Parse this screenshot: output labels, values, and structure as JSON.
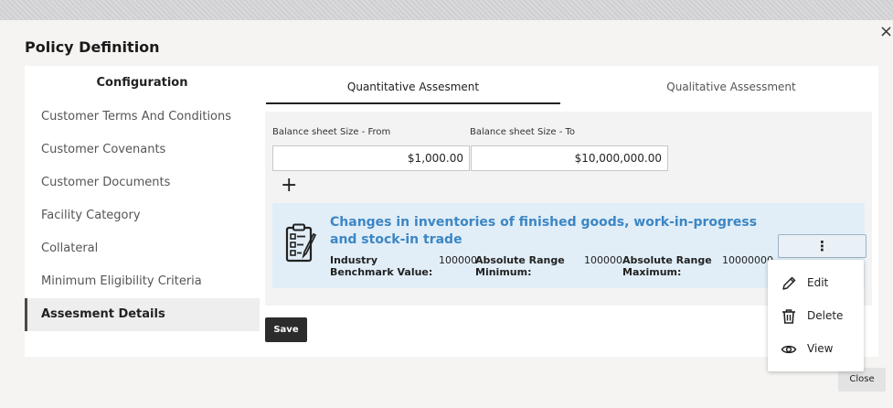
{
  "modal": {
    "title": "Policy Definition",
    "close_x": "×",
    "close_button": "Close"
  },
  "sidebar": {
    "header": "Configuration",
    "items": [
      {
        "label": "Customer Terms And Conditions"
      },
      {
        "label": "Customer Covenants"
      },
      {
        "label": "Customer Documents"
      },
      {
        "label": "Facility Category"
      },
      {
        "label": "Collateral"
      },
      {
        "label": "Minimum Eligibility Criteria"
      },
      {
        "label": "Assesment Details",
        "active": true
      }
    ]
  },
  "tabs": [
    {
      "label": "Quantitative Assesment",
      "active": true
    },
    {
      "label": "Qualitative Assessment"
    }
  ],
  "form": {
    "from_label": "Balance sheet Size - From",
    "from_value": "$1,000.00",
    "to_label": "Balance sheet Size - To",
    "to_value": "$10,000,000.00",
    "add_label": "+"
  },
  "card": {
    "icon": "checklist-icon",
    "title": "Changes in inventories of finished goods, work-in-progress and stock-in trade",
    "industry_label_1": "Industry",
    "industry_label_2": "Benchmark Value:",
    "industry_value": "100000",
    "min_label_1": "Absolute Range",
    "min_label_2": "Minimum:",
    "min_value": "100000",
    "max_label_1": "Absolute Range",
    "max_label_2": "Maximum:",
    "max_value": "10000000",
    "menu_button": "⋮"
  },
  "save_button": "Save",
  "context_menu": [
    {
      "label": "Edit",
      "icon": "pencil-icon"
    },
    {
      "label": "Delete",
      "icon": "trash-icon"
    },
    {
      "label": "View",
      "icon": "eye-icon"
    }
  ],
  "colors": {
    "accent": "#3c86c4",
    "card_bg": "#e1eef7",
    "save_bg": "#2c2c2c"
  }
}
